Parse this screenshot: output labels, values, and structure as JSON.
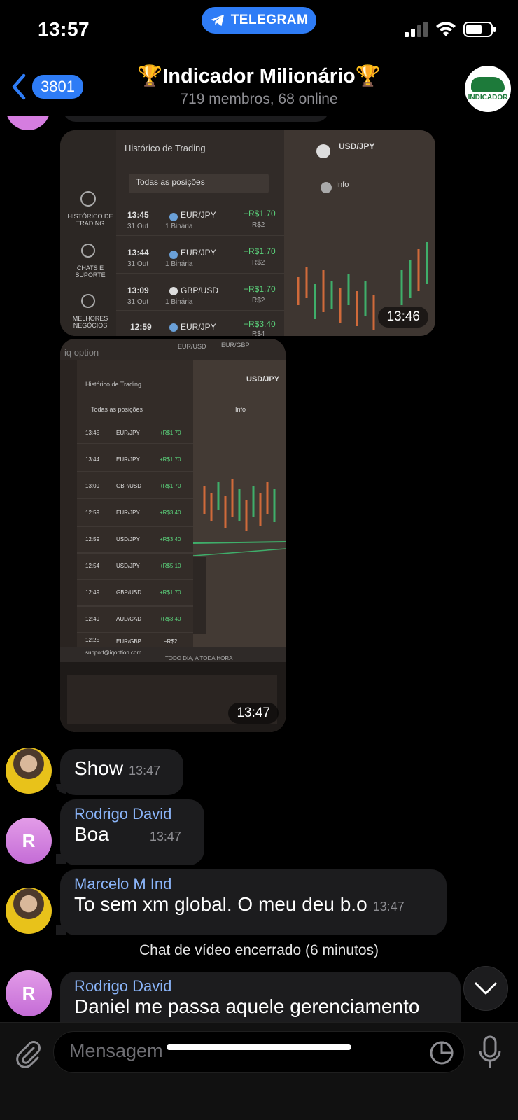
{
  "status_bar": {
    "time": "13:57",
    "app_pill": "TELEGRAM"
  },
  "header": {
    "back_count": "3801",
    "title": "🏆Indicador Milionário🏆",
    "subtitle": "719 membros, 68 online",
    "avatar_text": "INDICADOR"
  },
  "photos": [
    {
      "time": "13:46",
      "panel_title": "Histórico de Trading",
      "filter": "Todas as posições",
      "symbol": "USD/JPY",
      "info": "Info",
      "side_menu": [
        "HISTÓRICO DE TRADING",
        "CHATS E SUPORTE",
        "MELHORES NEGÓCIOS"
      ],
      "rows": [
        {
          "time": "13:45",
          "date": "31 Out",
          "pair": "EUR/JPY",
          "kind": "1 Binária",
          "profit": "+R$1.70",
          "stake": "R$2"
        },
        {
          "time": "13:44",
          "date": "31 Out",
          "pair": "EUR/JPY",
          "kind": "1 Binária",
          "profit": "+R$1.70",
          "stake": "R$2"
        },
        {
          "time": "13:09",
          "date": "31 Out",
          "pair": "GBP/USD",
          "kind": "1 Binária",
          "profit": "+R$1.70",
          "stake": "R$2"
        },
        {
          "time": "12:59",
          "date": "31 Out",
          "pair": "EUR/JPY",
          "kind": "",
          "profit": "+R$3.40",
          "stake": "R$4"
        }
      ]
    },
    {
      "time": "13:47",
      "brand": "iq option",
      "tabs": [
        "EUR/USD",
        "EUR/GBP"
      ],
      "panel_title": "Histórico de Trading",
      "filter": "Todas as posições",
      "symbol": "USD/JPY",
      "info": "Info",
      "footer_email": "support@iqoption.com",
      "footer_tagline": "TODO DIA, A TODA HORA",
      "rows": [
        {
          "time": "13:45",
          "pair": "EUR/JPY",
          "profit": "+R$1.70"
        },
        {
          "time": "13:44",
          "pair": "EUR/JPY",
          "profit": "+R$1.70"
        },
        {
          "time": "13:09",
          "pair": "GBP/USD",
          "profit": "+R$1.70"
        },
        {
          "time": "12:59",
          "pair": "EUR/JPY",
          "profit": "+R$3.40"
        },
        {
          "time": "12:59",
          "pair": "USD/JPY",
          "profit": "+R$3.40"
        },
        {
          "time": "12:54",
          "pair": "USD/JPY",
          "profit": "+R$5.10"
        },
        {
          "time": "12:49",
          "pair": "GBP/USD",
          "profit": "+R$1.70"
        },
        {
          "time": "12:49",
          "pair": "AUD/CAD",
          "profit": "+R$3.40"
        },
        {
          "time": "12:25",
          "pair": "EUR/GBP",
          "profit": "−R$2"
        }
      ]
    }
  ],
  "messages": [
    {
      "sender": "",
      "text": "Show",
      "time": "13:47"
    },
    {
      "sender": "Rodrigo David",
      "avatar_letter": "R",
      "text": "Boa",
      "time": "13:47"
    },
    {
      "sender": "Marcelo M Ind",
      "text": "To sem xm global. O meu deu b.o",
      "time": "13:47"
    },
    {
      "sender": "Rodrigo David",
      "avatar_letter": "R",
      "text": "Daniel me passa aquele gerenciamento",
      "time": ""
    }
  ],
  "service_message": "Chat de vídeo encerrado (6 minutos)",
  "input": {
    "placeholder": "Mensagem"
  }
}
